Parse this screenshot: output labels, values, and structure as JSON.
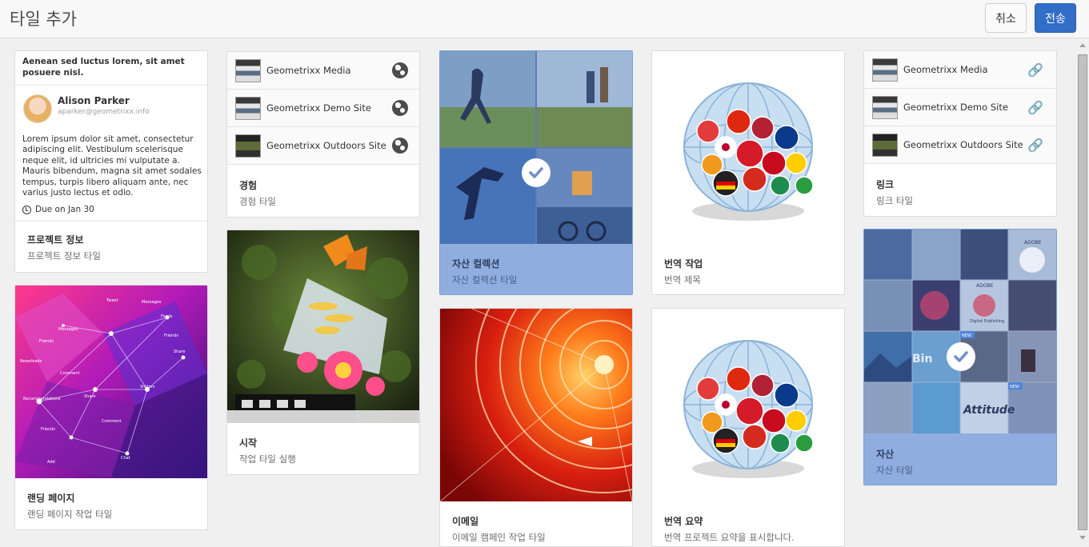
{
  "header": {
    "title": "타일 추가",
    "cancel_label": "취소",
    "submit_label": "전송"
  },
  "tiles": {
    "project_info": {
      "heading": "Aenean sed luctus lorem, sit amet posuere nisl.",
      "person_name": "Alison Parker",
      "person_email": "aparker@geometrixx.info",
      "body": "Lorem ipsum dolor sit amet, consectetur adipiscing elit. Vestibulum scelerisque neque elit, id ultricies mi vulputate a. Mauris bibendum, magna sit amet sodales tempus, turpis libero aliquam ante, nec varius justo lectus et odio.",
      "due": "Due on Jan 30",
      "title": "프로젝트 정보",
      "subtitle": "프로젝트 정보 타일"
    },
    "landing_page": {
      "title": "랜딩 페이지",
      "subtitle": "랜딩 페이지 작업 타일",
      "image_labels": [
        "Tweet",
        "Messages",
        "Messages",
        "Friends",
        "Feeds",
        "Friends",
        "Share",
        "Newsfeeds",
        "Comment",
        "Visitors",
        "Share",
        "Recommendations",
        "Friends",
        "Comment",
        "Chat",
        "Add"
      ]
    },
    "experience": {
      "sites": [
        "Geometrixx Media",
        "Geometrixx Demo Site",
        "Geometrixx Outdoors Site"
      ],
      "title": "경험",
      "subtitle": "경험 타일"
    },
    "start": {
      "title": "시작",
      "subtitle": "작업 타일 실행"
    },
    "asset_collection": {
      "title": "자산 컬렉션",
      "subtitle": "자산 컬렉션 타일"
    },
    "email": {
      "title": "이메일",
      "subtitle": "이메일 캠페인 작업 타일"
    },
    "translation_job": {
      "title": "번역 작업",
      "subtitle": "번역 제목"
    },
    "translation_summary": {
      "title": "번역 요약",
      "subtitle": "번역 프로젝트 요약을 표시합니다."
    },
    "link": {
      "sites": [
        "Geometrixx Media",
        "Geometrixx Demo Site",
        "Geometrixx Outdoors Site"
      ],
      "title": "링크",
      "subtitle": "링크 타일"
    },
    "assets": {
      "title": "자산",
      "subtitle": "자산 타일",
      "mosaic_labels": [
        "ADOBE",
        "ADOBE",
        "Digital Publishing",
        "NEW",
        "Bin",
        "NEW",
        "Attitude"
      ]
    }
  },
  "colors": {
    "accent": "#326ec8",
    "selected_card": "#8faddf",
    "background": "#f0f0f0"
  }
}
